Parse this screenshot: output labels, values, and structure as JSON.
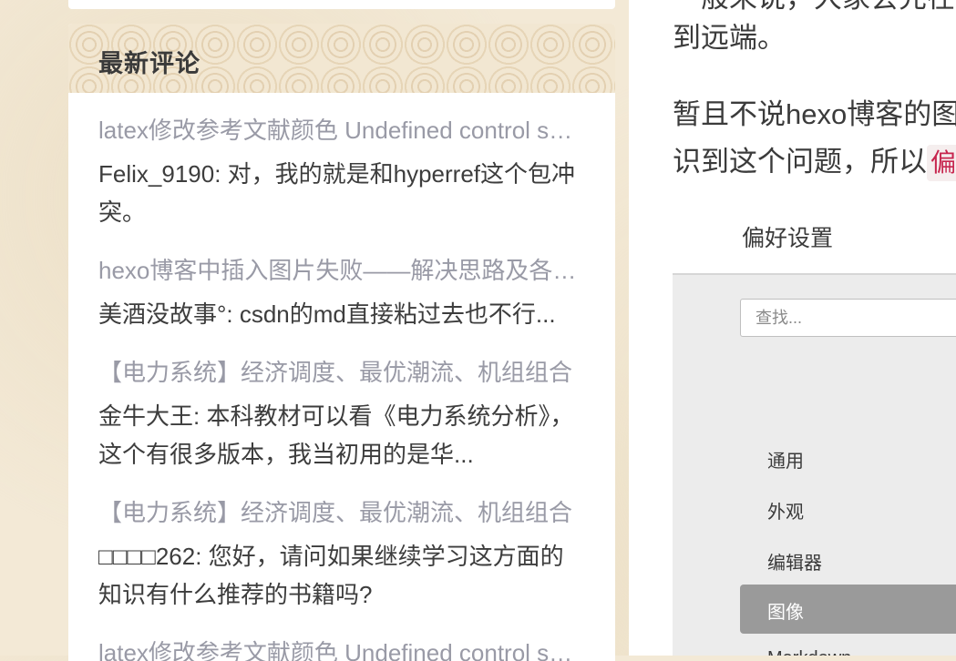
{
  "sidebar": {
    "section_title": "最新评论",
    "comments": [
      {
        "post_title": "latex修改参考文献颜色 Undefined control sequence",
        "body": "Felix_9190: 对，我的就是和hyperref这个包冲突。"
      },
      {
        "post_title": "hexo博客中插入图片失败——解决思路及各种方法总结",
        "body": "美酒没故事°: csdn的md直接粘过去也不行..."
      },
      {
        "post_title": "【电力系统】经济调度、最优潮流、机组组合",
        "body": "金牛大王: 本科教材可以看《电力系统分析》，这个有很多版本，我当初用的是华..."
      },
      {
        "post_title": "【电力系统】经济调度、最优潮流、机组组合",
        "body": "□□□□262: 您好，请问如果继续学习这方面的知识有什么推荐的书籍吗?"
      },
      {
        "post_title": "latex修改参考文献颜色 Undefined control sequence",
        "body": ""
      }
    ]
  },
  "post": {
    "line_top_partial": "一般来说，大家会先在",
    "line1": "到远端。",
    "line2": "暂且不说hexo博客的图",
    "line3": "识到这个问题，所以",
    "inline_code": "偏",
    "screenshot": {
      "title": "偏好设置",
      "search_placeholder": "查找...",
      "nav": [
        "通用",
        "外观",
        "编辑器",
        "图像",
        "Markdown"
      ],
      "active_index": 3
    }
  }
}
